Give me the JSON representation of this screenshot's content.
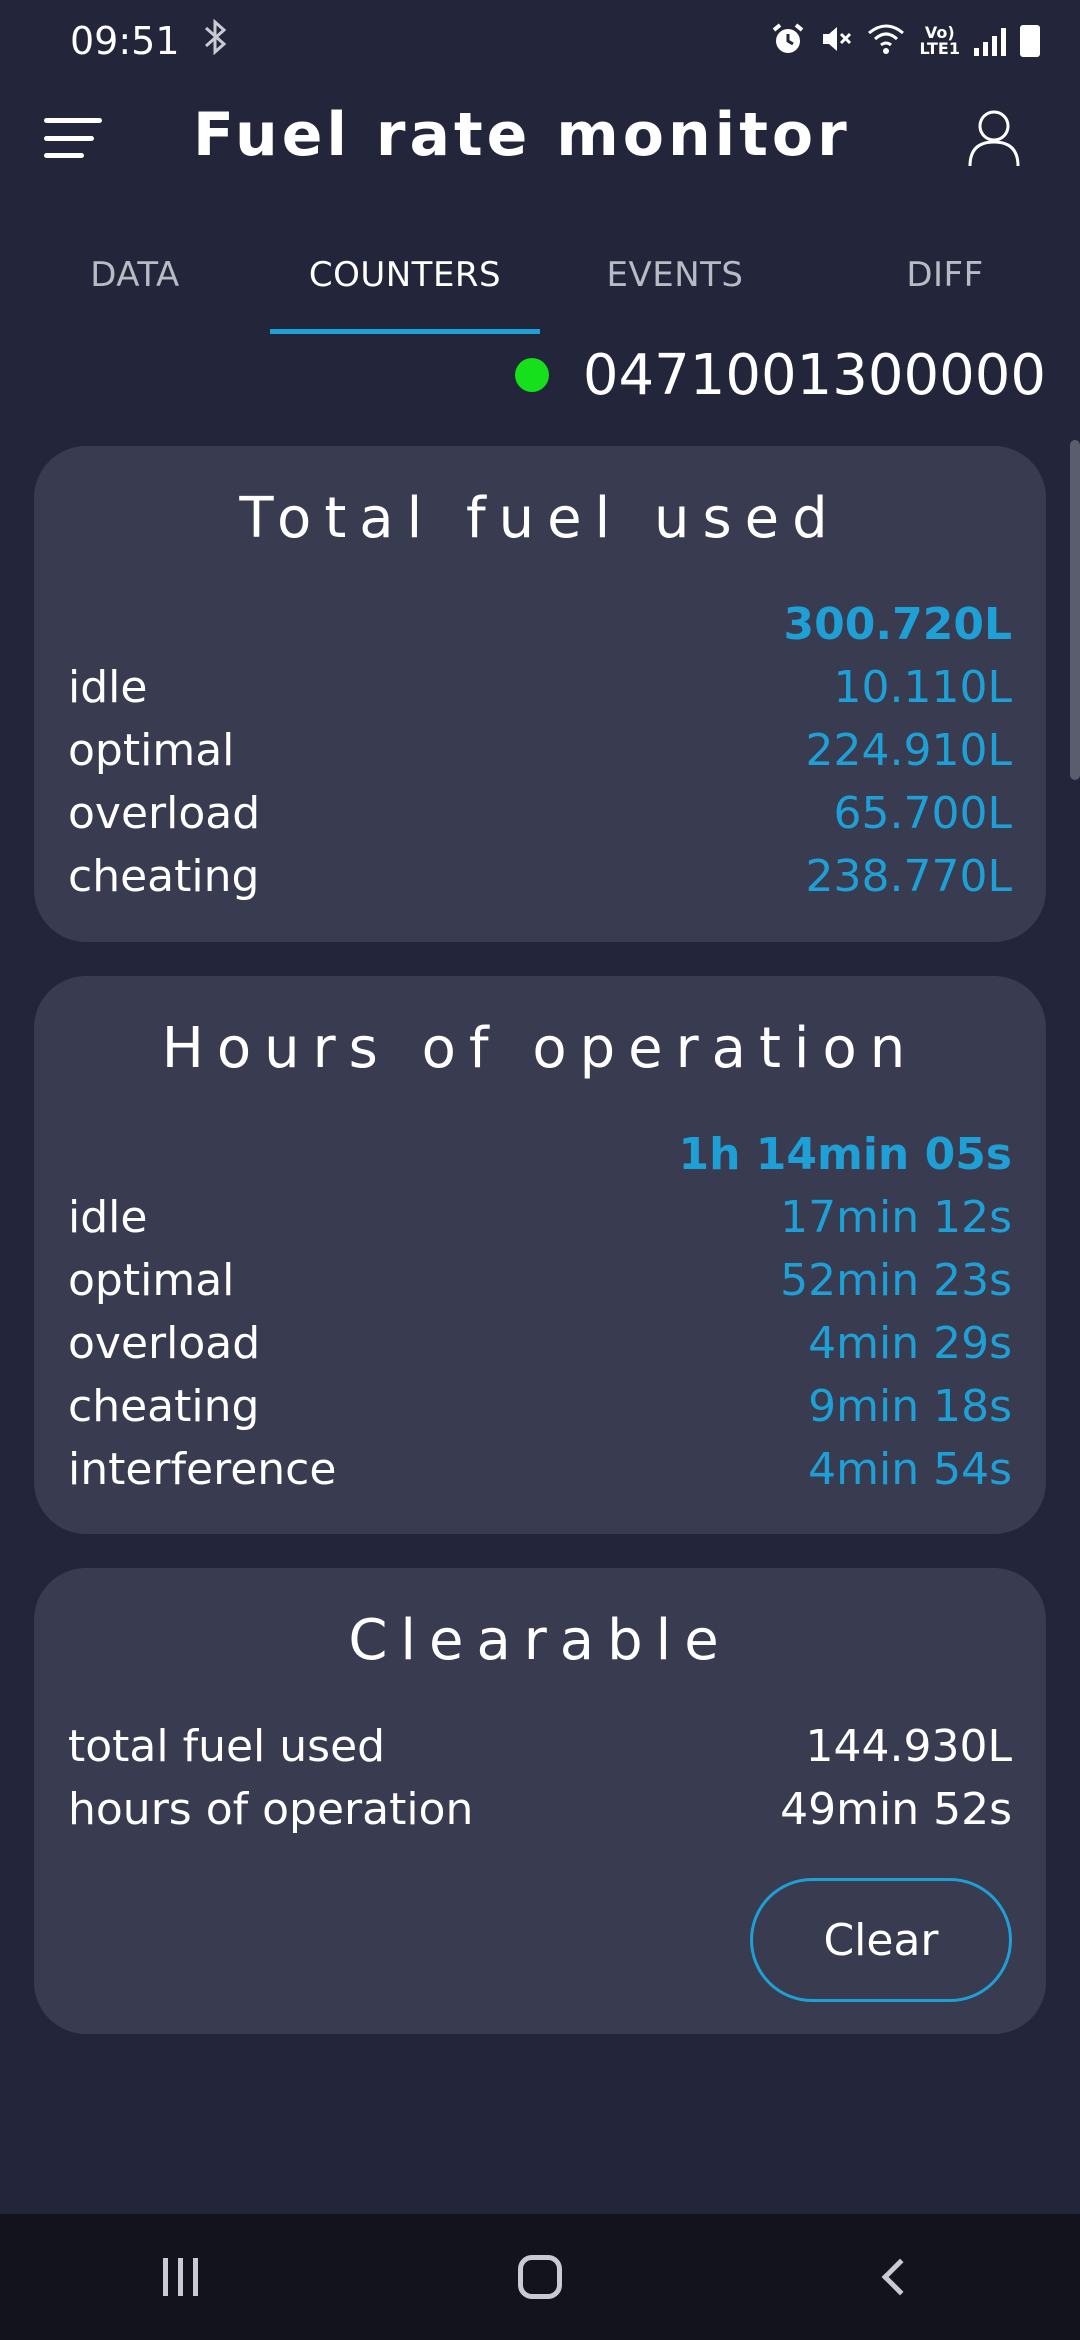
{
  "status_bar": {
    "time": "09:51",
    "icons": [
      "bluetooth-icon",
      "alarm-icon",
      "mute-icon",
      "wifi-icon",
      "volte-icon",
      "signal-icon",
      "battery-icon"
    ],
    "volte_line1": "Vo)",
    "volte_line2": "LTE1"
  },
  "app_bar": {
    "title": "Fuel rate monitor",
    "menu_icon": "hamburger-menu-icon",
    "account_icon": "account-icon"
  },
  "tabs": [
    {
      "label": "DATA",
      "active": false
    },
    {
      "label": "COUNTERS",
      "active": true
    },
    {
      "label": "EVENTS",
      "active": false
    },
    {
      "label": "DIFF",
      "active": false
    }
  ],
  "device": {
    "id": "0471001300000",
    "status_color": "#16e01c"
  },
  "total_fuel": {
    "title": "Total fuel used",
    "total": "300.720L",
    "rows": [
      {
        "label": "idle",
        "value": "10.110L"
      },
      {
        "label": "optimal",
        "value": "224.910L"
      },
      {
        "label": "overload",
        "value": "65.700L"
      },
      {
        "label": "cheating",
        "value": "238.770L"
      }
    ]
  },
  "hours": {
    "title": "Hours of operation",
    "total": "1h 14min 05s",
    "rows": [
      {
        "label": "idle",
        "value": "17min 12s"
      },
      {
        "label": "optimal",
        "value": "52min 23s"
      },
      {
        "label": "overload",
        "value": "4min 29s"
      },
      {
        "label": "cheating",
        "value": "9min 18s"
      },
      {
        "label": "interference",
        "value": "4min 54s"
      }
    ]
  },
  "clearable": {
    "title": "Clearable",
    "rows": [
      {
        "label": "total fuel used",
        "value": "144.930L"
      },
      {
        "label": "hours of operation",
        "value": "49min 52s"
      }
    ],
    "clear_label": "Clear"
  },
  "colors": {
    "background": "#23263a",
    "card": "#393c50",
    "accent": "#1e9fd6",
    "online": "#16e01c"
  },
  "nav_bar": {
    "icons": [
      "recents-icon",
      "home-icon",
      "back-icon"
    ]
  }
}
